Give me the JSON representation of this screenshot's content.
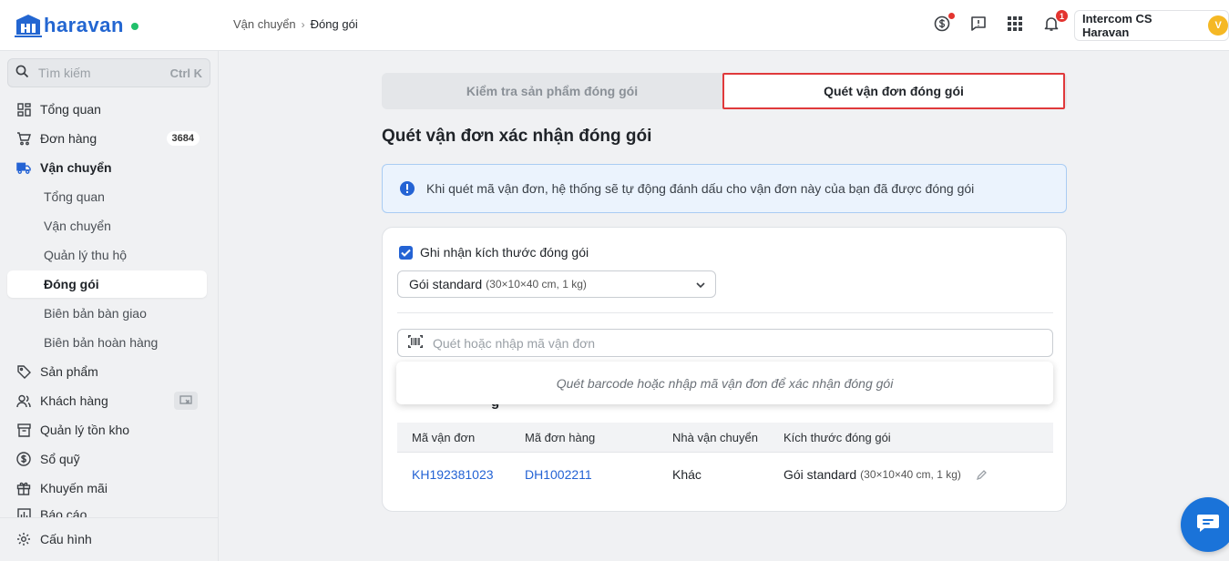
{
  "brand": {
    "name": "haravan"
  },
  "breadcrumb": {
    "parent": "Vận chuyển",
    "separator": "›",
    "current": "Đóng gói"
  },
  "topbar": {
    "notification_count": "1",
    "account_name": "Intercom CS Haravan",
    "avatar_initial": "V"
  },
  "sidebar": {
    "search_placeholder": "Tìm kiếm",
    "search_shortcut": "Ctrl K",
    "items": [
      {
        "label": "Tổng quan",
        "icon": "dashboard-icon"
      },
      {
        "label": "Đơn hàng",
        "icon": "cart-icon",
        "badge": "3684"
      },
      {
        "label": "Vận chuyển",
        "icon": "truck-icon"
      },
      {
        "label": "Tổng quan"
      },
      {
        "label": "Vận chuyển"
      },
      {
        "label": "Quản lý thu hộ"
      },
      {
        "label": "Đóng gói"
      },
      {
        "label": "Biên bản bàn giao"
      },
      {
        "label": "Biên bản hoàn hàng"
      },
      {
        "label": "Sản phẩm",
        "icon": "tag-icon"
      },
      {
        "label": "Khách hàng",
        "icon": "users-icon"
      },
      {
        "label": "Quản lý tồn kho",
        "icon": "warehouse-icon"
      },
      {
        "label": "Sổ quỹ",
        "icon": "dollar-icon"
      },
      {
        "label": "Khuyến mãi",
        "icon": "gift-icon"
      },
      {
        "label": "Báo cáo",
        "icon": "chart-icon"
      }
    ],
    "settings_label": "Cấu hình"
  },
  "main": {
    "tabs": [
      {
        "label": "Kiểm tra sản phẩm đóng gói"
      },
      {
        "label": "Quét vận đơn đóng gói"
      }
    ],
    "title": "Quét vận đơn xác nhận đóng gói",
    "info_text": "Khi quét mã vận đơn, hệ thống sẽ tự động đánh dấu cho vận đơn này của bạn đã được đóng gói",
    "record_size_label": "Ghi nhận kích thước đóng gói",
    "package_select": {
      "name": "Gói standard",
      "detail": "(30×10×40 cm, 1 kg)"
    },
    "scan_placeholder": "Quét hoặc nhập mã vận đơn",
    "dropdown_hint": "Quét barcode hoặc nhập mã vận đơn để xác nhận đóng gói",
    "table": {
      "columns": [
        "Mã vận đơn",
        "Mã đơn hàng",
        "Nhà vận chuyển",
        "Kích thước đóng gói"
      ],
      "rows": [
        {
          "shipment": "KH192381023",
          "order": "DH1002211",
          "carrier": "Khác",
          "package": "Gói standard",
          "package_detail": "(30×10×40 cm, 1 kg)"
        }
      ]
    }
  },
  "colors": {
    "brand": "#2366d1",
    "primary": "#2463d4",
    "highlight_border": "#e0393b",
    "info_bg": "#ebf3fd"
  }
}
